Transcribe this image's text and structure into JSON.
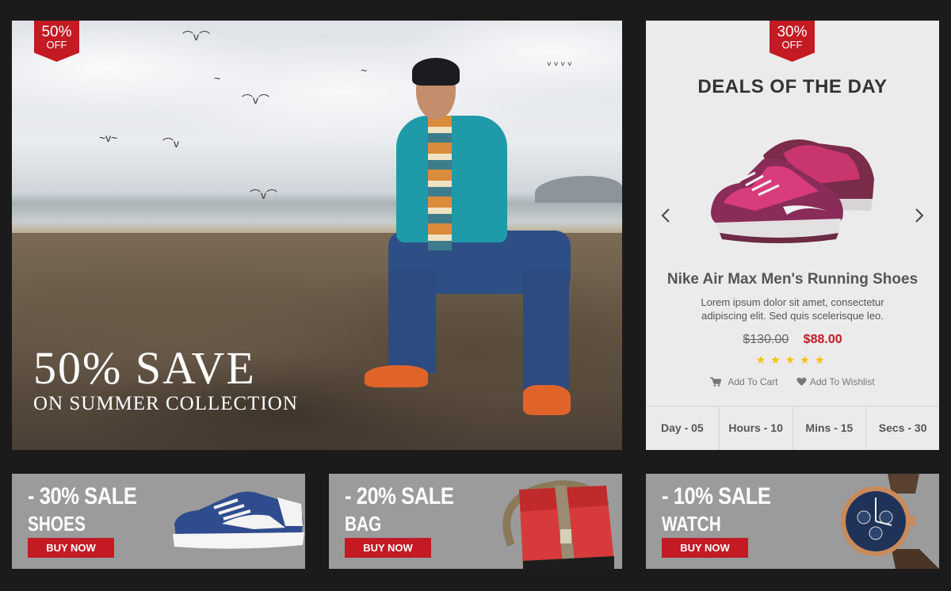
{
  "hero": {
    "ribbon": {
      "percent": "50%",
      "off": "OFF"
    },
    "headline": "50% SAVE",
    "subline": "ON SUMMER COLLECTION"
  },
  "deals": {
    "ribbon": {
      "percent": "30%",
      "off": "OFF"
    },
    "title": "DEALS OF THE DAY",
    "prev_icon": "chevron-left",
    "next_icon": "chevron-right",
    "product": {
      "name": "Nike Air Max Men's Running Shoes",
      "description": "Lorem ipsum dolor sit amet, consectetur adipiscing elit. Sed quis scelerisque leo.",
      "old_price": "$130.00",
      "new_price": "$88.00",
      "rating": 5
    },
    "actions": {
      "add_to_cart": "Add To Cart",
      "add_to_wishlist": "Add To Wishlist"
    },
    "countdown": [
      {
        "label": "Day - 05"
      },
      {
        "label": "Hours - 10"
      },
      {
        "label": "Mins - 15"
      },
      {
        "label": "Secs - 30"
      }
    ]
  },
  "banners": [
    {
      "sale": "- 30% SALE",
      "category": "SHOES",
      "button": "BUY NOW"
    },
    {
      "sale": "- 20% SALE",
      "category": "BAG",
      "button": "BUY NOW"
    },
    {
      "sale": "- 10% SALE",
      "category": "WATCH",
      "button": "BUY NOW"
    }
  ],
  "colors": {
    "accent": "#c31a23",
    "page_bg": "#1b1b1b",
    "panel_bg": "#ebebeb",
    "banner_bg": "#9b9b9b",
    "star": "#f5c400"
  }
}
